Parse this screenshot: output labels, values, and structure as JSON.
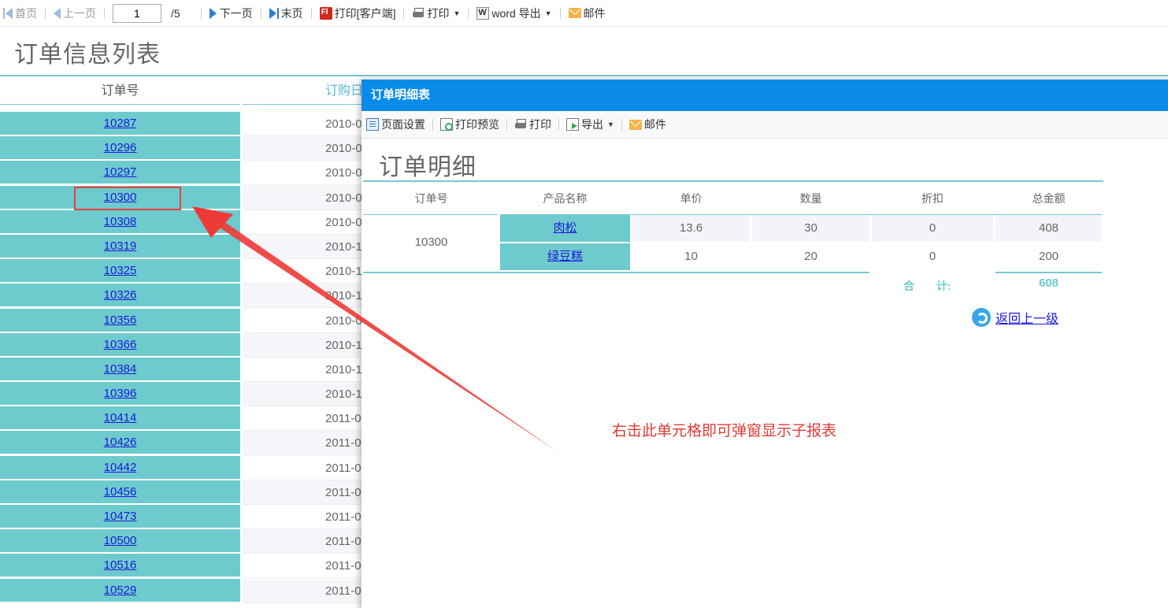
{
  "toolbar": {
    "first": "首页",
    "prev": "上一页",
    "page_value": "1",
    "page_total": "/5",
    "next": "下一页",
    "last": "末页",
    "print_client": "打印[客户端]",
    "print": "打印",
    "word_export": "word 导出",
    "mail": "邮件"
  },
  "report": {
    "title": "订单信息列表",
    "col_order": "订单号",
    "col_date": "订购日",
    "rows": [
      {
        "id": "10287",
        "date": "2010-0"
      },
      {
        "id": "10296",
        "date": "2010-0"
      },
      {
        "id": "10297",
        "date": "2010-0"
      },
      {
        "id": "10300",
        "date": "2010-0"
      },
      {
        "id": "10308",
        "date": "2010-0"
      },
      {
        "id": "10319",
        "date": "2010-1"
      },
      {
        "id": "10325",
        "date": "2010-1"
      },
      {
        "id": "10326",
        "date": "2010-1"
      },
      {
        "id": "10356",
        "date": "2010-0"
      },
      {
        "id": "10366",
        "date": "2010-1"
      },
      {
        "id": "10384",
        "date": "2010-1"
      },
      {
        "id": "10396",
        "date": "2010-1"
      },
      {
        "id": "10414",
        "date": "2011-0"
      },
      {
        "id": "10426",
        "date": "2011-0"
      },
      {
        "id": "10442",
        "date": "2011-0"
      },
      {
        "id": "10456",
        "date": "2011-0"
      },
      {
        "id": "10473",
        "date": "2011-0"
      },
      {
        "id": "10500",
        "date": "2011-0"
      },
      {
        "id": "10516",
        "date": "2011-0"
      },
      {
        "id": "10529",
        "date": "2011-0"
      }
    ]
  },
  "dialog": {
    "title": "订单明细表",
    "toolbar": {
      "page_setup": "页面设置",
      "print_preview": "打印预览",
      "print": "打印",
      "export": "导出",
      "mail": "邮件"
    },
    "sub_title": "订单明细",
    "columns": [
      "订单号",
      "产品名称",
      "单价",
      "数量",
      "折扣",
      "总金额"
    ],
    "order_id": "10300",
    "items": [
      {
        "product": "肉松",
        "price": "13.6",
        "qty": "30",
        "discount": "0",
        "amount": "408"
      },
      {
        "product": "绿豆糕",
        "price": "10",
        "qty": "20",
        "discount": "0",
        "amount": "200"
      }
    ],
    "total_label": "合　　计:",
    "total_value": "608",
    "back": "返回上一级"
  },
  "annotation": "右击此单元格即可弹窗显示子报表",
  "colors": {
    "teal": "#6ecbcd",
    "dialog_header": "#0b8be9",
    "annotation_red": "#e03a33",
    "link_blue": "#1a1adb"
  }
}
